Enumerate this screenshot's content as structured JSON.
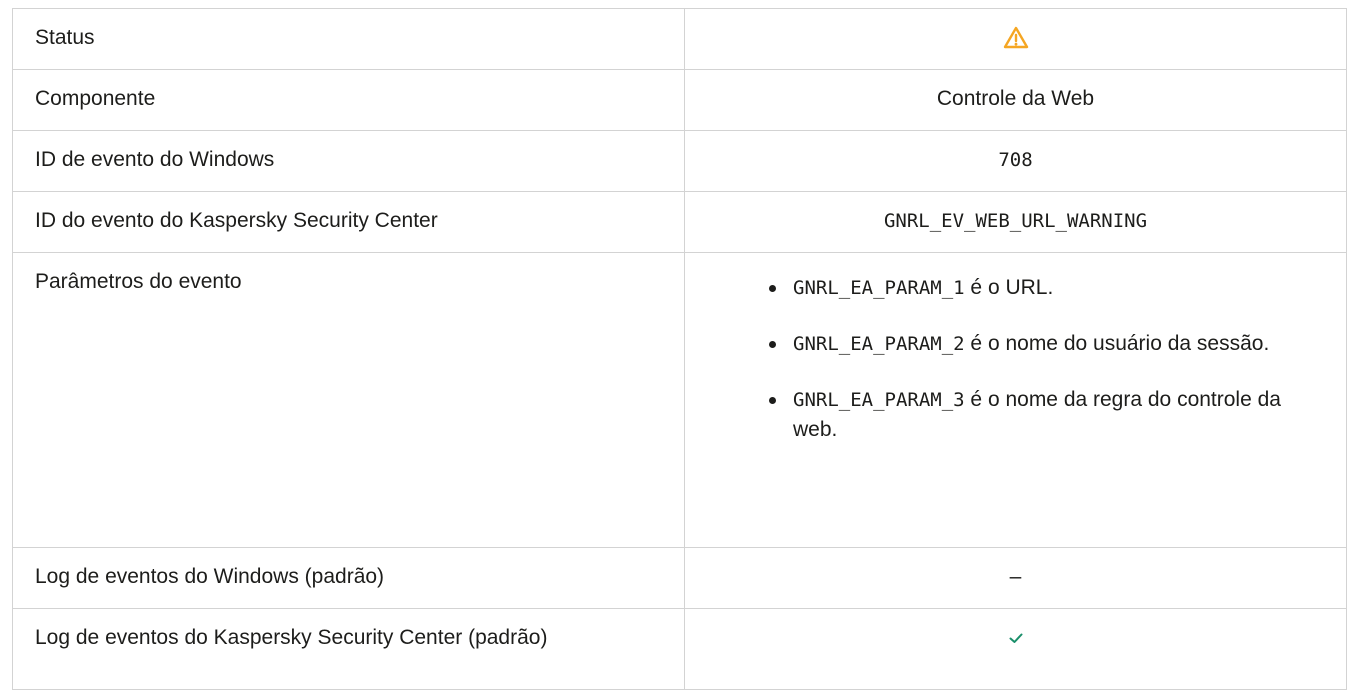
{
  "rows": {
    "status": {
      "label": "Status",
      "icon": "warning-triangle-icon",
      "icon_color": "#f5a623"
    },
    "component": {
      "label": "Componente",
      "value": "Controle da Web"
    },
    "windows_event_id": {
      "label": "ID de evento do Windows",
      "value": "708"
    },
    "ksc_event_id": {
      "label": "ID do evento do Kaspersky Security Center",
      "value": "GNRL_EV_WEB_URL_WARNING"
    },
    "event_params": {
      "label": "Parâmetros do evento",
      "items": [
        {
          "code": "GNRL_EA_PARAM_1",
          "text": " é o URL."
        },
        {
          "code": "GNRL_EA_PARAM_2",
          "text": " é o nome do usuário da sessão."
        },
        {
          "code": "GNRL_EA_PARAM_3",
          "text": " é o nome da regra do controle da web."
        }
      ]
    },
    "windows_log": {
      "label": "Log de eventos do Windows (padrão)",
      "value": "–"
    },
    "ksc_log": {
      "label": "Log de eventos do Kaspersky Security Center (padrão)",
      "icon": "checkmark-icon",
      "icon_color": "#1a8f6a"
    }
  }
}
